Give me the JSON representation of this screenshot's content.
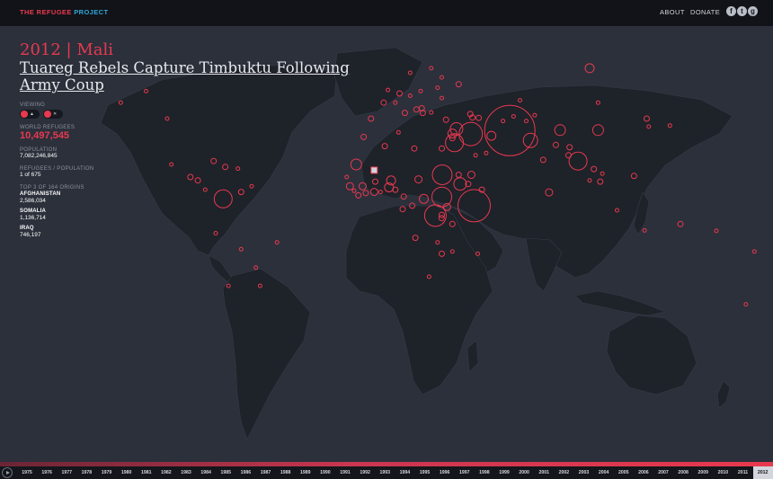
{
  "header": {
    "brand_part1": "THE REFUGEE",
    "brand_part2": "PROJECT",
    "nav": [
      {
        "label": "ABOUT"
      },
      {
        "label": "DONATE"
      }
    ],
    "social": [
      {
        "icon": "facebook-icon",
        "glyph": "f"
      },
      {
        "icon": "twitter-icon",
        "glyph": "t"
      },
      {
        "icon": "google-plus-icon",
        "glyph": "g"
      }
    ]
  },
  "story": {
    "year_country": "2012 | Mali",
    "title": "Tuareg Rebels Capture Timbuktu Following Army Coup"
  },
  "stats": {
    "viewing_label": "VIEWING",
    "viewing_buttons": [
      {
        "icon": "refugees-person-icon",
        "glyph": "▲"
      },
      {
        "icon": "displaced-person-icon",
        "glyph": "✕"
      }
    ],
    "world_refugees_label": "WORLD REFUGEES",
    "world_refugees": "10,497,545",
    "population_label": "POPULATION",
    "population": "7,082,246,845",
    "ratio_label": "REFUGEES / POPULATION",
    "ratio": "1 of 675",
    "top_label": "TOP 3 OF 164 ORIGINS",
    "origins": [
      {
        "name": "AFGHANISTAN",
        "value": "2,586,034"
      },
      {
        "name": "SOMALIA",
        "value": "1,136,714"
      },
      {
        "name": "IRAQ",
        "value": "746,197"
      }
    ]
  },
  "colors": {
    "accent": "#e8394f",
    "background": "#2b303b",
    "land": "#1e2229",
    "header": "#111318"
  },
  "map": {
    "selected_country": "Mali",
    "selected_marker_icon": "selected-country-marker",
    "bubbles": [
      {
        "lon": 62.2,
        "lat": 34.8,
        "r": 28
      },
      {
        "lon": 45.3,
        "lat": 2.0,
        "r": 18
      },
      {
        "lon": 43.7,
        "lat": 33.3,
        "r": 13
      },
      {
        "lon": 72.0,
        "lat": 30.5,
        "r": 8
      },
      {
        "lon": 30.2,
        "lat": 15.5,
        "r": 11
      },
      {
        "lon": 30.0,
        "lat": 5.8,
        "r": 11
      },
      {
        "lon": 38.7,
        "lat": 11.5,
        "r": 7
      },
      {
        "lon": 27.0,
        "lat": -2.3,
        "r": 12
      },
      {
        "lon": 21.5,
        "lat": 5.0,
        "r": 5
      },
      {
        "lon": -73.5,
        "lat": 5.0,
        "r": 10
      },
      {
        "lon": 94.5,
        "lat": 21.5,
        "r": 10
      },
      {
        "lon": 86.0,
        "lat": 35.0,
        "r": 6
      },
      {
        "lon": 37.0,
        "lat": 35.5,
        "r": 7
      },
      {
        "lon": 36.0,
        "lat": 29.5,
        "r": 10
      },
      {
        "lon": 35.0,
        "lat": 33.5,
        "r": 5
      },
      {
        "lon": 80.8,
        "lat": 7.8,
        "r": 4
      },
      {
        "lon": 53.5,
        "lat": 32.5,
        "r": 5
      },
      {
        "lon": 100.0,
        "lat": 62.0,
        "r": 5
      },
      {
        "lon": 6.0,
        "lat": 13.0,
        "r": 5
      },
      {
        "lon": 5.0,
        "lat": 10.0,
        "r": 5
      },
      {
        "lon": -10.5,
        "lat": 20.0,
        "r": 6
      },
      {
        "lon": -7.5,
        "lat": 10.5,
        "r": 4
      },
      {
        "lon": -13.5,
        "lat": 10.5,
        "r": 4
      },
      {
        "lon": -2.0,
        "lat": 8.0,
        "r": 4
      },
      {
        "lon": -6.0,
        "lat": 7.5,
        "r": 3
      },
      {
        "lon": 19.0,
        "lat": 13.5,
        "r": 4
      },
      {
        "lon": 16.0,
        "lat": 2.0,
        "r": 3
      },
      {
        "lon": -72.5,
        "lat": 18.9,
        "r": 3
      },
      {
        "lon": -89.0,
        "lat": 14.5,
        "r": 3
      },
      {
        "lon": -85.5,
        "lat": 13.0,
        "r": 3
      },
      {
        "lon": -78.0,
        "lat": 21.5,
        "r": 3
      },
      {
        "lon": -66.5,
        "lat": 18.2,
        "r": 2
      },
      {
        "lon": -65.0,
        "lat": 8.0,
        "r": 3
      },
      {
        "lon": -60.0,
        "lat": 10.5,
        "r": 2
      },
      {
        "lon": -98.0,
        "lat": 20.0,
        "r": 2
      },
      {
        "lon": -82.0,
        "lat": 9.0,
        "r": 2
      },
      {
        "lon": -77.0,
        "lat": -10.0,
        "r": 2
      },
      {
        "lon": -65.0,
        "lat": -17.0,
        "r": 2
      },
      {
        "lon": -58.0,
        "lat": -25.0,
        "r": 2
      },
      {
        "lon": -71.0,
        "lat": -33.0,
        "r": 2
      },
      {
        "lon": -48.0,
        "lat": -14.0,
        "r": 2
      },
      {
        "lon": -56.0,
        "lat": -33.0,
        "r": 2
      },
      {
        "lon": -100.0,
        "lat": 40.0,
        "r": 2
      },
      {
        "lon": -122.0,
        "lat": 47.0,
        "r": 2
      },
      {
        "lon": -110.0,
        "lat": 52.0,
        "r": 2
      },
      {
        "lon": 2.5,
        "lat": 47.0,
        "r": 3
      },
      {
        "lon": 10.0,
        "lat": 51.0,
        "r": 3
      },
      {
        "lon": -3.5,
        "lat": 40.0,
        "r": 3
      },
      {
        "lon": 12.5,
        "lat": 42.5,
        "r": 3
      },
      {
        "lon": 20.5,
        "lat": 44.5,
        "r": 3
      },
      {
        "lon": 18.0,
        "lat": 44.0,
        "r": 3
      },
      {
        "lon": 21.0,
        "lat": 42.5,
        "r": 3
      },
      {
        "lon": 25.0,
        "lat": 42.7,
        "r": 2
      },
      {
        "lon": 20.0,
        "lat": 52.0,
        "r": 2
      },
      {
        "lon": 30.0,
        "lat": 49.0,
        "r": 2
      },
      {
        "lon": 44.5,
        "lat": 40.5,
        "r": 3
      },
      {
        "lon": 47.5,
        "lat": 40.3,
        "r": 3
      },
      {
        "lon": 43.5,
        "lat": 42.0,
        "r": 3
      },
      {
        "lon": 38.0,
        "lat": 55.0,
        "r": 3
      },
      {
        "lon": 28.0,
        "lat": 53.5,
        "r": 2
      },
      {
        "lon": 15.0,
        "lat": 60.0,
        "r": 2
      },
      {
        "lon": 25.0,
        "lat": 62.0,
        "r": 2
      },
      {
        "lon": 30.0,
        "lat": 58.0,
        "r": 2
      },
      {
        "lon": 4.5,
        "lat": 52.5,
        "r": 2
      },
      {
        "lon": 8.0,
        "lat": 47.0,
        "r": 2
      },
      {
        "lon": 15.0,
        "lat": 50.0,
        "r": 2
      },
      {
        "lon": 32.0,
        "lat": 39.5,
        "r": 3
      },
      {
        "lon": 35.0,
        "lat": 31.5,
        "r": 3
      },
      {
        "lon": 44.0,
        "lat": 15.5,
        "r": 4
      },
      {
        "lon": 51.0,
        "lat": 25.0,
        "r": 2
      },
      {
        "lon": 46.0,
        "lat": 24.0,
        "r": 2
      },
      {
        "lon": 30.0,
        "lat": 27.0,
        "r": 3
      },
      {
        "lon": 17.0,
        "lat": 27.0,
        "r": 3
      },
      {
        "lon": 3.0,
        "lat": 28.0,
        "r": 3
      },
      {
        "lon": -7.0,
        "lat": 32.0,
        "r": 3
      },
      {
        "lon": 9.5,
        "lat": 34.0,
        "r": 2
      },
      {
        "lon": 42.5,
        "lat": 11.5,
        "r": 3
      },
      {
        "lon": 38.0,
        "lat": 15.5,
        "r": 3
      },
      {
        "lon": 30.0,
        "lat": -2.0,
        "r": 3
      },
      {
        "lon": 29.9,
        "lat": -3.4,
        "r": 3
      },
      {
        "lon": 32.5,
        "lat": 1.5,
        "r": 4
      },
      {
        "lon": 35.0,
        "lat": -6.0,
        "r": 3
      },
      {
        "lon": 17.5,
        "lat": -12.0,
        "r": 3
      },
      {
        "lon": 30.0,
        "lat": -19.0,
        "r": 3
      },
      {
        "lon": 28.0,
        "lat": -14.0,
        "r": 2
      },
      {
        "lon": 35.0,
        "lat": -18.0,
        "r": 2
      },
      {
        "lon": 24.0,
        "lat": -29.0,
        "r": 2
      },
      {
        "lon": 47.0,
        "lat": -19.0,
        "r": 2
      },
      {
        "lon": 12.0,
        "lat": 6.0,
        "r": 3
      },
      {
        "lon": 11.5,
        "lat": 0.5,
        "r": 3
      },
      {
        "lon": 8.0,
        "lat": 9.0,
        "r": 3
      },
      {
        "lon": 1.0,
        "lat": 8.0,
        "r": 2
      },
      {
        "lon": -11.5,
        "lat": 8.5,
        "r": 2
      },
      {
        "lon": -9.5,
        "lat": 6.5,
        "r": 3
      },
      {
        "lon": -15.0,
        "lat": 14.5,
        "r": 2
      },
      {
        "lon": -1.5,
        "lat": 12.5,
        "r": 3
      },
      {
        "lon": 49.0,
        "lat": 9.0,
        "r": 3
      },
      {
        "lon": 104.0,
        "lat": 35.0,
        "r": 6
      },
      {
        "lon": 90.5,
        "lat": 27.5,
        "r": 3
      },
      {
        "lon": 84.0,
        "lat": 28.5,
        "r": 3
      },
      {
        "lon": 90.0,
        "lat": 24.0,
        "r": 3
      },
      {
        "lon": 78.0,
        "lat": 22.0,
        "r": 3
      },
      {
        "lon": 102.0,
        "lat": 18.0,
        "r": 3
      },
      {
        "lon": 105.0,
        "lat": 12.5,
        "r": 3
      },
      {
        "lon": 106.0,
        "lat": 16.0,
        "r": 2
      },
      {
        "lon": 100.0,
        "lat": 13.0,
        "r": 2
      },
      {
        "lon": 121.0,
        "lat": 15.0,
        "r": 3
      },
      {
        "lon": 113.0,
        "lat": 0.0,
        "r": 2
      },
      {
        "lon": 127.0,
        "lat": 40.0,
        "r": 3
      },
      {
        "lon": 128.0,
        "lat": 36.5,
        "r": 2
      },
      {
        "lon": 138.0,
        "lat": 37.0,
        "r": 2
      },
      {
        "lon": 104.0,
        "lat": 47.0,
        "r": 2
      },
      {
        "lon": 67.0,
        "lat": 48.0,
        "r": 2
      },
      {
        "lon": 59.0,
        "lat": 39.0,
        "r": 2
      },
      {
        "lon": 70.0,
        "lat": 39.0,
        "r": 2
      },
      {
        "lon": 74.0,
        "lat": 41.5,
        "r": 2
      },
      {
        "lon": 64.0,
        "lat": 41.0,
        "r": 2
      },
      {
        "lon": 143.0,
        "lat": -6.0,
        "r": 3
      },
      {
        "lon": 126.0,
        "lat": -8.8,
        "r": 2
      },
      {
        "lon": 160.0,
        "lat": -9.0,
        "r": 2
      },
      {
        "lon": 178.0,
        "lat": -18.0,
        "r": 2
      },
      {
        "lon": 174.0,
        "lat": -41.0,
        "r": 2
      }
    ]
  },
  "timeline": {
    "years": [
      "1975",
      "1976",
      "1977",
      "1978",
      "1979",
      "1980",
      "1981",
      "1982",
      "1983",
      "1984",
      "1985",
      "1986",
      "1987",
      "1988",
      "1989",
      "1990",
      "1991",
      "1992",
      "1993",
      "1994",
      "1995",
      "1996",
      "1997",
      "1998",
      "1999",
      "2000",
      "2001",
      "2002",
      "2003",
      "2004",
      "2005",
      "2006",
      "2007",
      "2008",
      "2009",
      "2010",
      "2011",
      "2012"
    ],
    "active_year": "2012",
    "progress": 1.0
  }
}
